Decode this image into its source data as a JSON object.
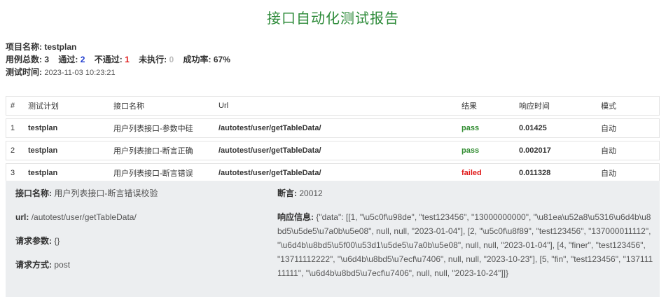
{
  "report": {
    "title": "接口自动化测试报告",
    "project_label": "项目名称:",
    "project_name": "testplan",
    "total_label": "用例总数:",
    "total": "3",
    "pass_label": "通过:",
    "pass": "2",
    "fail_label": "不通过:",
    "fail": "1",
    "skip_label": "未执行:",
    "skip": "0",
    "rate_label": "成功率:",
    "rate": "67%",
    "time_label": "测试时间:",
    "time": "2023-11-03 10:23:21"
  },
  "table": {
    "headers": [
      "#",
      "测试计划",
      "接口名称",
      "Url",
      "结果",
      "响应时间",
      "模式"
    ],
    "rows": [
      {
        "idx": "1",
        "plan": "testplan",
        "name": "用户列表接口-参数中硅",
        "url": "/autotest/user/getTableData/",
        "result": "pass",
        "time": "0.01425",
        "mode": "自动"
      },
      {
        "idx": "2",
        "plan": "testplan",
        "name": "用户列表接口-断言正确",
        "url": "/autotest/user/getTableData/",
        "result": "pass",
        "time": "0.002017",
        "mode": "自动"
      },
      {
        "idx": "3",
        "plan": "testplan",
        "name": "用户列表接口-断言错误",
        "url": "/autotest/user/getTableData/",
        "result": "failed",
        "time": "0.011328",
        "mode": "自动"
      }
    ]
  },
  "detail": {
    "name_label": "接口名称:",
    "name": "用户列表接口-断言错误校验",
    "url_label": "url:",
    "url": "/autotest/user/getTableData/",
    "params_label": "请求参数:",
    "params": "{}",
    "method_label": "请求方式:",
    "method": "post",
    "assert_label": "断言:",
    "assert": "20012",
    "response_label": "响应信息:",
    "response": "{\"data\": [[1, \"\\u5c0f\\u98de\", \"test123456\", \"13000000000\", \"\\u81ea\\u52a8\\u5316\\u6d4b\\u8bd5\\u5de5\\u7a0b\\u5e08\", null, null, \"2023-01-04\"], [2, \"\\u5c0f\\u8f89\", \"test123456\", \"137000011112\", \"\\u6d4b\\u8bd5\\u5f00\\u53d1\\u5de5\\u7a0b\\u5e08\", null, null, \"2023-01-04\"], [4, \"finer\", \"test123456\", \"13711112222\", \"\\u6d4b\\u8bd5\\u7ecf\\u7406\", null, null, \"2023-10-23\"], [5, \"fin\", \"test123456\", \"13711111111\", \"\\u6d4b\\u8bd5\\u7ecf\\u7406\", null, null, \"2023-10-24\"]]}"
  }
}
